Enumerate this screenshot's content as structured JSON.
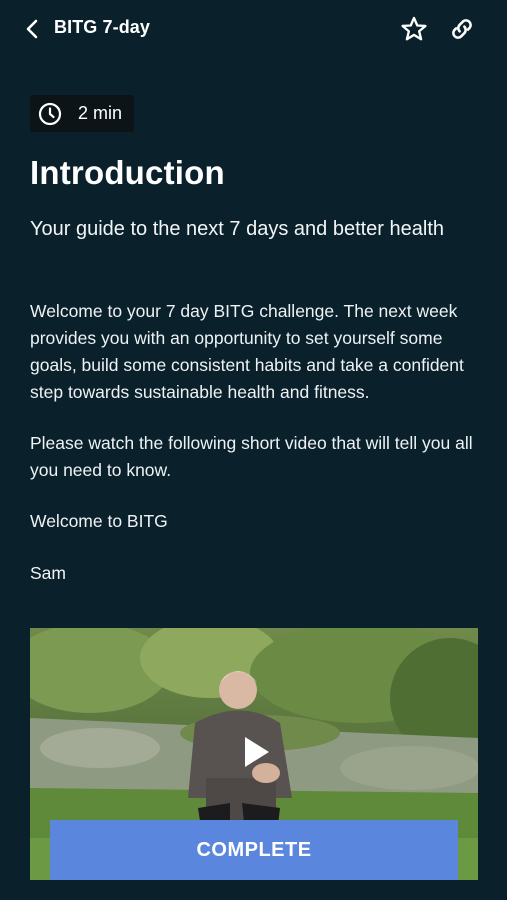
{
  "header": {
    "title": "BITG 7-day",
    "back_icon": "chevron-left-icon",
    "favorite_icon": "star-outline-icon",
    "share_icon": "link-icon"
  },
  "meta": {
    "duration": "2 min",
    "duration_icon": "clock-icon"
  },
  "content": {
    "title": "Introduction",
    "subtitle": "Your guide to the next 7 days and better health",
    "paragraphs": [
      "Welcome to your 7 day BITG challenge. The next week provides you with an opportunity to set yourself some goals, build some consistent habits and take a confident step towards sustainable health and fitness.",
      "Please watch the following short video that will tell you all you need to know.",
      "Welcome to BITG",
      "Sam"
    ]
  },
  "video": {
    "play_icon": "play-icon"
  },
  "actions": {
    "complete_label": "COMPLETE"
  },
  "colors": {
    "background": "#0a212c",
    "chip_background": "#0d1418",
    "primary_button": "#5b86de",
    "text": "#ffffff"
  }
}
